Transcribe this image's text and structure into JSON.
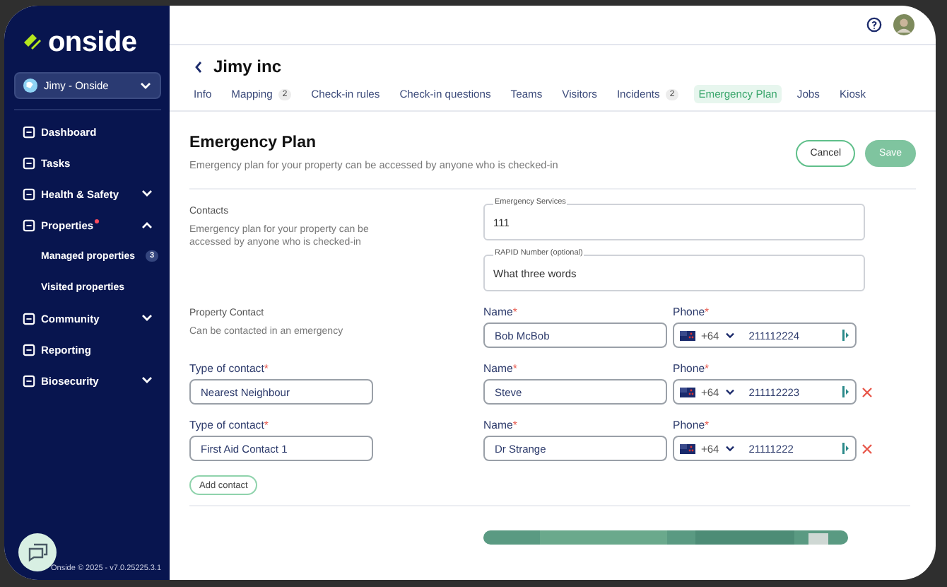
{
  "sidebar": {
    "logo": "onside",
    "org": "Jimy - Onside",
    "items": [
      {
        "label": "Dashboard"
      },
      {
        "label": "Tasks"
      },
      {
        "label": "Health & Safety",
        "expanded": false
      },
      {
        "label": "Properties",
        "expanded": true,
        "required": true,
        "children": [
          {
            "label": "Managed properties",
            "badge": "3"
          },
          {
            "label": "Visited properties"
          }
        ]
      },
      {
        "label": "Community",
        "expanded": false
      },
      {
        "label": "Reporting"
      },
      {
        "label": "Biosecurity",
        "expanded": false
      }
    ],
    "footer": "Onside © 2025 - v7.0.25225.3.1"
  },
  "page": {
    "title": "Jimy inc",
    "tabs": [
      {
        "label": "Info",
        "selected": false
      },
      {
        "label": "Mapping",
        "badge": "2",
        "selected": false
      },
      {
        "label": "Check-in rules",
        "selected": false
      },
      {
        "label": "Check-in questions",
        "selected": false
      },
      {
        "label": "Teams",
        "selected": false
      },
      {
        "label": "Visitors",
        "selected": false
      },
      {
        "label": "Incidents",
        "badge": "2",
        "selected": false
      },
      {
        "label": "Emergency Plan",
        "selected": true
      },
      {
        "label": "Jobs",
        "selected": false
      },
      {
        "label": "Kiosk",
        "selected": false
      }
    ]
  },
  "plan": {
    "heading": "Emergency Plan",
    "subtitle": "Emergency plan for your property can be accessed by anyone who is checked-in",
    "buttons": [
      {
        "label": "Cancel",
        "disabled": false,
        "kind": "outline"
      },
      {
        "label": "Save",
        "disabled": true,
        "kind": "filled"
      }
    ],
    "contacts": {
      "title": "Contacts",
      "description": "Emergency plan for your property can be accessed by anyone who is checked-in",
      "fields": [
        {
          "label": "Emergency Services",
          "value": "111"
        },
        {
          "label": "RAPID Number (optional)",
          "value": "What three words"
        }
      ]
    },
    "property_contact": {
      "title": "Property Contact",
      "description": "Can be contacted in an emergency"
    },
    "rows": [
      {
        "name_label": "Name",
        "name_mark": "*",
        "name": "Bob McBob",
        "phone_label": "Phone",
        "phone_mark": "*",
        "code": "+64",
        "phone": "211112224",
        "removable": false
      },
      {
        "type_label": "Type of contact",
        "type_mark": "*",
        "type": "Nearest Neighbour",
        "name_label": "Name",
        "name_mark": "*",
        "name": "Steve",
        "phone_label": "Phone",
        "phone_mark": "*",
        "code": "+64",
        "phone": "211112223",
        "removable": true
      },
      {
        "type_label": "Type of contact",
        "type_mark": "*",
        "type": "First Aid Contact 1",
        "name_label": "Name",
        "name_mark": "*",
        "name": "Dr Strange",
        "phone_label": "Phone",
        "phone_mark": "*",
        "code": "+64",
        "phone": "21111222",
        "removable": true
      }
    ],
    "add_button": "Add contact"
  }
}
